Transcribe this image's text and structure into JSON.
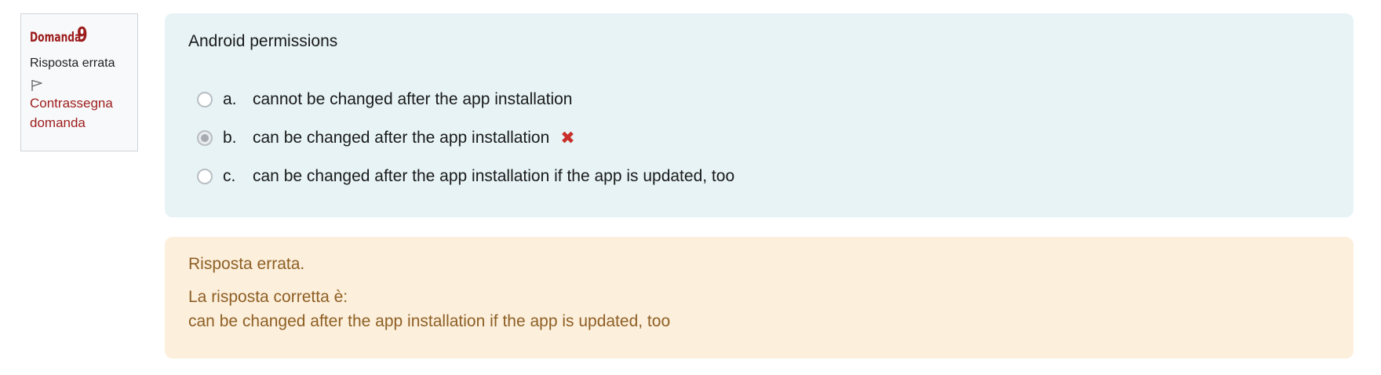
{
  "info": {
    "question_word": "Domanda",
    "question_number": "9",
    "state": "Risposta errata",
    "flag_label_line1": "Contrassegna",
    "flag_label_line2": "domanda"
  },
  "question": {
    "text": "Android permissions",
    "answers": [
      {
        "letter": "a.",
        "text": "cannot be changed after the app installation",
        "selected": false
      },
      {
        "letter": "b.",
        "text": "can be changed after the app installation",
        "selected": true,
        "mark": "✖"
      },
      {
        "letter": "c.",
        "text": "can be changed after the app installation if the app is updated, too",
        "selected": false
      }
    ]
  },
  "feedback": {
    "result": "Risposta errata.",
    "correct_label": "La risposta corretta è:",
    "correct_answer": "can be changed after the app installation if the app is updated, too"
  },
  "colors": {
    "accent": "#9d1c1c",
    "question_bg": "#e7f3f5",
    "feedback_bg": "#fcefdc",
    "feedback_text": "#8e5f24",
    "wrong_mark": "#c9302c"
  }
}
